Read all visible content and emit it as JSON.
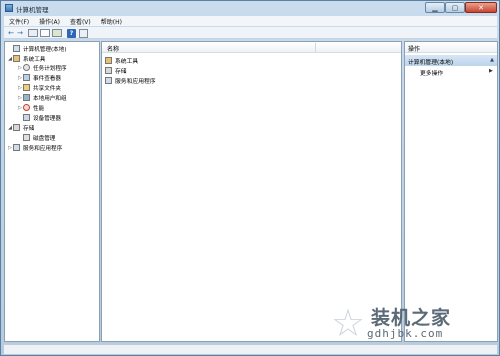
{
  "window": {
    "title": "计算机管理"
  },
  "menubar": {
    "items": [
      "文件(F)",
      "操作(A)",
      "查看(V)",
      "帮助(H)"
    ]
  },
  "toolbar": {
    "back": "←",
    "forward": "→",
    "help": "?"
  },
  "tree": {
    "root": "计算机管理(本地)",
    "system_tools": "系统工具",
    "task_scheduler": "任务计划程序",
    "event_viewer": "事件查看器",
    "shared_folders": "共享文件夹",
    "local_users": "本地用户和组",
    "performance": "性能",
    "device_manager": "设备管理器",
    "storage": "存储",
    "disk_management": "磁盘管理",
    "services_apps": "服务和应用程序"
  },
  "list": {
    "column_name": "名称",
    "items": [
      "系统工具",
      "存储",
      "服务和应用程序"
    ]
  },
  "actions": {
    "header": "操作",
    "selected": "计算机管理(本地)",
    "more": "更多操作"
  },
  "watermark": {
    "text": "装机之家",
    "url": "gdhjbk.com"
  },
  "colors": {
    "titlebar": "#c9dced",
    "selection": "#bcd4ec",
    "pane_border": "#8da0b3"
  }
}
